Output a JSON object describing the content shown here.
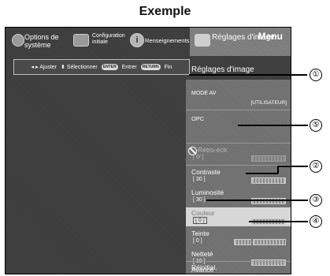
{
  "page_title": "Exemple",
  "tabs": [
    {
      "label": "Options de système",
      "icon": "system-options-icon"
    },
    {
      "label": "Configuration initiale",
      "icon": "setup-icon"
    },
    {
      "label": "Renseignements",
      "icon": "info-icon"
    },
    {
      "label": "Réglages d'image",
      "icon": "picture-icon",
      "selected": true
    }
  ],
  "menu_label": "Menu",
  "hints": {
    "restore": "◂ ▸ Ajuster",
    "select": "⬍ Sélectionner",
    "enter_key": "ENTER",
    "enter": "Entrer",
    "return_key": "RETURN",
    "end": "Fin"
  },
  "section_title": "Réglages d'image",
  "items": {
    "mode_av": {
      "label": "MODE AV",
      "value": "[UTILISATEUR]"
    },
    "opc": {
      "label": "OPC"
    },
    "retro": {
      "label": "Rétro-éclr.",
      "value": "[ 0/ ]",
      "disabled": true
    },
    "contraste": {
      "label": "Contraste",
      "value": "[ 30 ]"
    },
    "luminosite": {
      "label": "Luminosité",
      "value": "[ 30 ]"
    },
    "couleur": {
      "label": "Couleur",
      "value": "[ 0 ]",
      "selected": true
    },
    "teinte": {
      "label": "Teinte",
      "value": "[ 0 ]"
    },
    "nettete": {
      "label": "Netteté",
      "value": "[ 10 ]"
    },
    "avance": {
      "label": "Avancé"
    },
    "reinit": {
      "label": "Réinitial."
    }
  },
  "callouts": [
    "①",
    "②",
    "③",
    "④",
    "⑤"
  ]
}
